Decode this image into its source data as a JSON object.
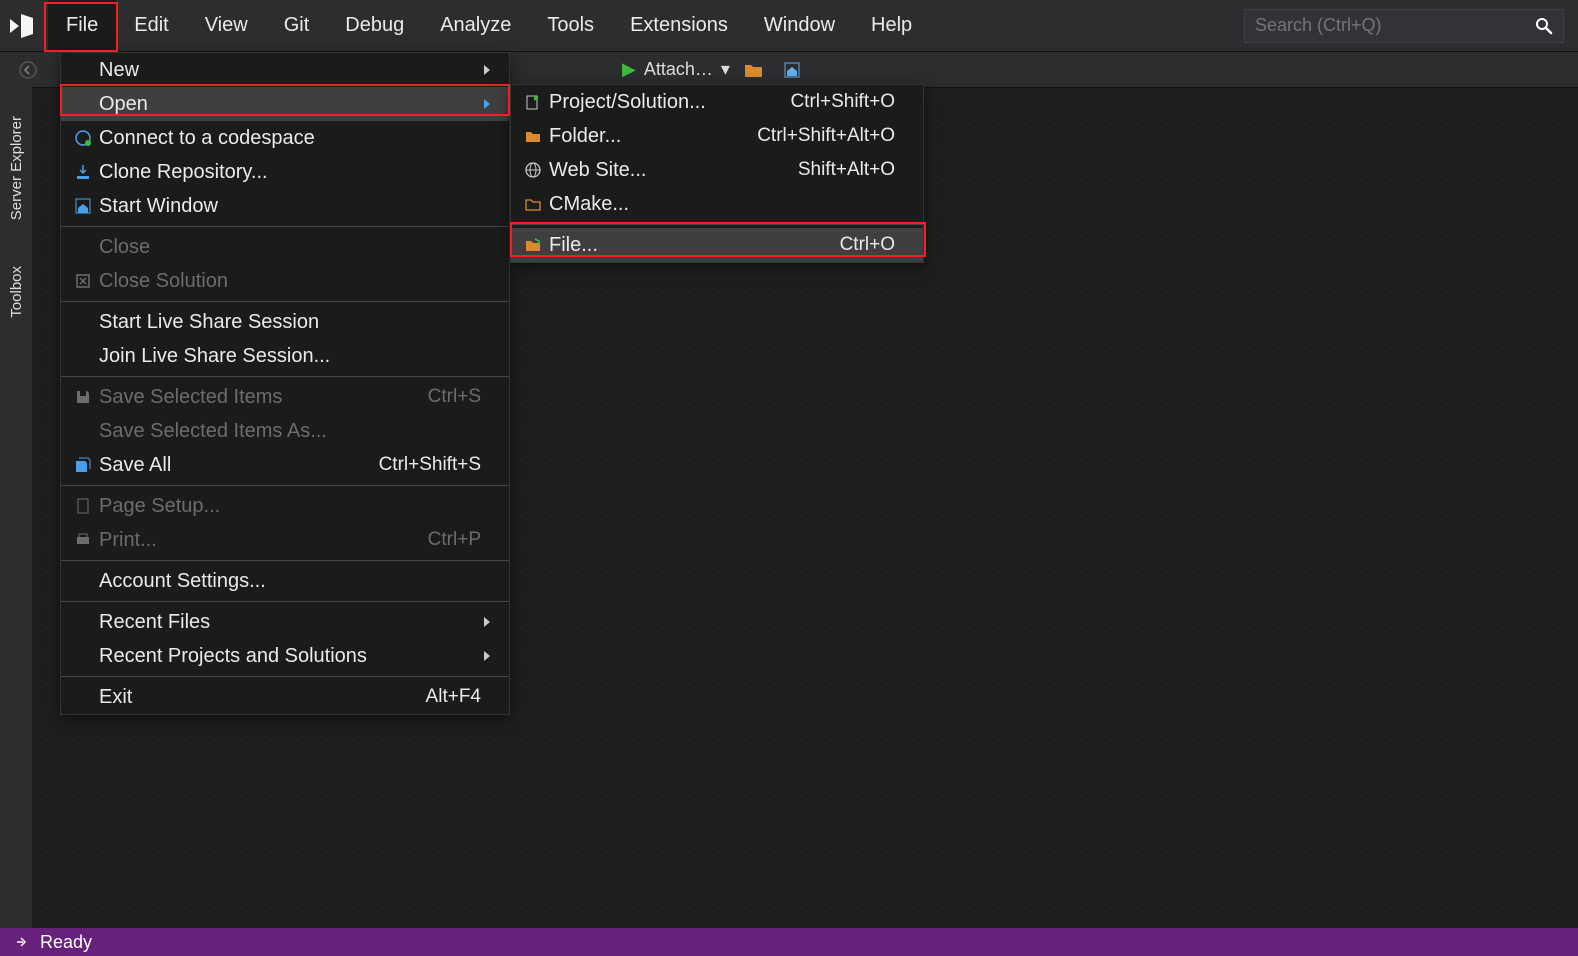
{
  "search_placeholder": "Search (Ctrl+Q)",
  "menubar": [
    {
      "label": "File",
      "active": true
    },
    {
      "label": "Edit"
    },
    {
      "label": "View"
    },
    {
      "label": "Git"
    },
    {
      "label": "Debug"
    },
    {
      "label": "Analyze"
    },
    {
      "label": "Tools"
    },
    {
      "label": "Extensions"
    },
    {
      "label": "Window"
    },
    {
      "label": "Help"
    }
  ],
  "toolbar_attach": "Attach…",
  "side_tabs": [
    "Server Explorer",
    "Toolbox"
  ],
  "file_menu": [
    {
      "label": "New",
      "sub": true,
      "icon": ""
    },
    {
      "label": "Open",
      "sub": true,
      "hover": true,
      "icon": ""
    },
    {
      "label": "Connect to a codespace",
      "icon": "connect"
    },
    {
      "label": "Clone Repository...",
      "icon": "download"
    },
    {
      "label": "Start Window",
      "icon": "home"
    },
    {
      "sep": true
    },
    {
      "label": "Close",
      "disabled": true
    },
    {
      "label": "Close Solution",
      "disabled": true,
      "icon": "close-sol"
    },
    {
      "sep": true
    },
    {
      "label": "Start Live Share Session"
    },
    {
      "label": "Join Live Share Session..."
    },
    {
      "sep": true
    },
    {
      "label": "Save Selected Items",
      "short": "Ctrl+S",
      "disabled": true,
      "icon": "save"
    },
    {
      "label": "Save Selected Items As...",
      "disabled": true
    },
    {
      "label": "Save All",
      "short": "Ctrl+Shift+S",
      "icon": "saveall"
    },
    {
      "sep": true
    },
    {
      "label": "Page Setup...",
      "disabled": true,
      "icon": "page"
    },
    {
      "label": "Print...",
      "short": "Ctrl+P",
      "disabled": true,
      "icon": "print"
    },
    {
      "sep": true
    },
    {
      "label": "Account Settings..."
    },
    {
      "sep": true
    },
    {
      "label": "Recent Files",
      "sub": true
    },
    {
      "label": "Recent Projects and Solutions",
      "sub": true
    },
    {
      "sep": true
    },
    {
      "label": "Exit",
      "short": "Alt+F4"
    }
  ],
  "open_submenu": [
    {
      "label": "Project/Solution...",
      "short": "Ctrl+Shift+O",
      "icon": "proj"
    },
    {
      "label": "Folder...",
      "short": "Ctrl+Shift+Alt+O",
      "icon": "folder"
    },
    {
      "label": "Web Site...",
      "short": "Shift+Alt+O",
      "icon": "globe"
    },
    {
      "label": "CMake...",
      "icon": "cmake"
    },
    {
      "sep": true
    },
    {
      "label": "File...",
      "short": "Ctrl+O",
      "icon": "file",
      "hover": true
    }
  ],
  "status_text": "Ready"
}
